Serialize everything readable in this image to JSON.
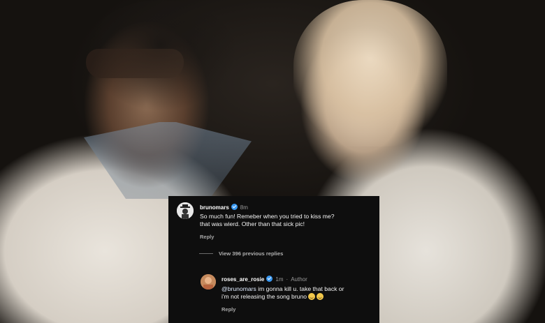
{
  "comments": [
    {
      "username": "brunomars",
      "time": "8m",
      "text": "So much fun! Remeber when you tried to kiss me?\nthat was wierd. Other than that sick pic!",
      "reply_label": "Reply"
    },
    {
      "username": "roses_are_rosie",
      "time": "1m",
      "author_label": "Author",
      "mention": "@brunomars",
      "text": " im gonna kill u. take that back or\ni'm not releasing the song bruno",
      "reply_label": "Reply"
    }
  ],
  "view_replies": "View 396 previous replies",
  "icons": {
    "verified": "verified-badge-icon",
    "emoji": "grimace-emoji-icon"
  },
  "colors": {
    "verified": "#3897f0",
    "panel": "#0e0e0e"
  }
}
